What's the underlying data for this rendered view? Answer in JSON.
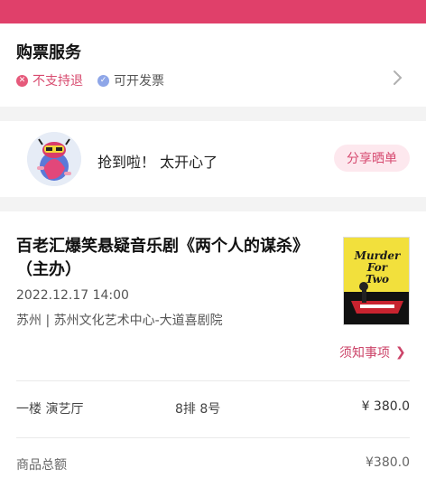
{
  "service": {
    "title": "购票服务",
    "tags": [
      {
        "label": "不支持退",
        "icon": "close-circle-icon",
        "color": "#d84b6f"
      },
      {
        "label": "可开发票",
        "icon": "check-circle-icon",
        "color": "#8ea6e8"
      }
    ]
  },
  "share": {
    "message": "抢到啦！ 太开心了",
    "button_label": "分享晒单"
  },
  "order": {
    "show_title": "百老汇爆笑悬疑音乐剧《两个人的谋杀》（主办）",
    "datetime": "2022.12.17 14:00",
    "venue": "苏州 | 苏州文化艺术中心-大道喜剧院",
    "poster_text": [
      "Murder",
      "For",
      "Two"
    ],
    "notice_label": "须知事项",
    "ticket": {
      "area": "一楼 演艺厅",
      "seat": "8排 8号",
      "price": "¥ 380.0"
    },
    "total": {
      "label": "商品总额",
      "value": "¥380.0"
    }
  },
  "colors": {
    "brand": "#e0406a",
    "accent_text": "#d64a70",
    "share_bg": "#fde8ee"
  }
}
